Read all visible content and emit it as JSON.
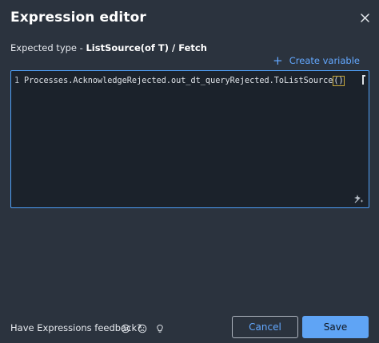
{
  "dialog": {
    "title": "Expression editor",
    "close_icon": "close-icon"
  },
  "expected_type": {
    "prefix": "Expected type - ",
    "value": "ListSource(of T) / Fetch"
  },
  "create_variable": {
    "icon": "plus-icon",
    "label": "Create variable"
  },
  "editor": {
    "line_number": "1",
    "code": "Processes.AcknowledgeRejected.out_dt_queryRejected.ToListSource",
    "paren_open": "(",
    "paren_close": ")",
    "assist_icon": "sparkle-icon"
  },
  "footer": {
    "feedback_label": "Have Expressions feedback?",
    "icons": [
      "smile-icon",
      "frown-icon",
      "lightbulb-icon"
    ],
    "cancel_label": "Cancel",
    "save_label": "Save"
  },
  "colors": {
    "background": "#2b333e",
    "editor_background": "#1b222b",
    "accent": "#5fa4f5",
    "link": "#63a8ff"
  }
}
